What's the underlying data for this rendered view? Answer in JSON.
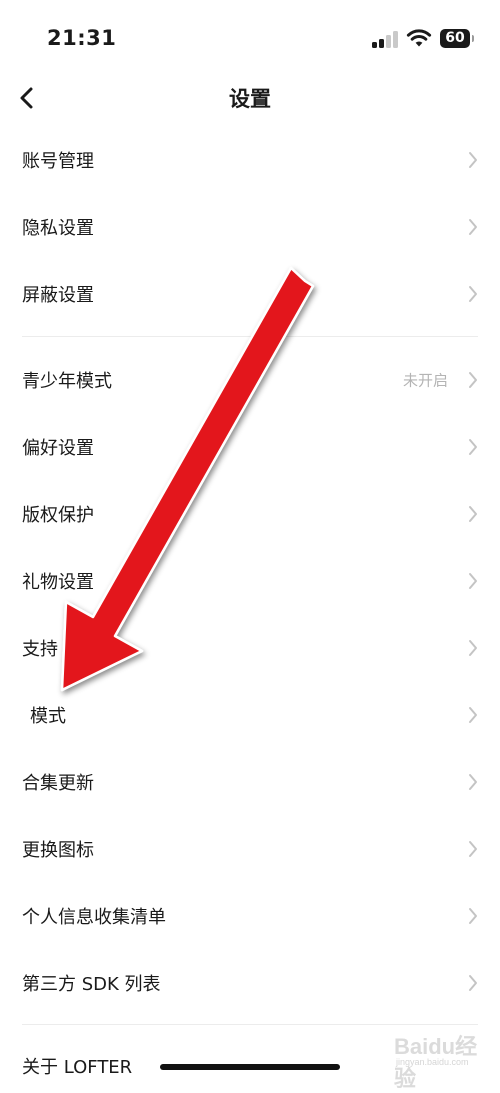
{
  "status_bar": {
    "time": "21:31",
    "battery": "60"
  },
  "nav": {
    "title": "设置"
  },
  "groups": [
    {
      "items": [
        {
          "label": "账号管理"
        },
        {
          "label": "隐私设置"
        },
        {
          "label": "屏蔽设置"
        }
      ]
    },
    {
      "items": [
        {
          "label": "青少年模式",
          "value": "未开启"
        },
        {
          "label": "偏好设置"
        },
        {
          "label": "版权保护"
        },
        {
          "label": "礼物设置"
        },
        {
          "label": "支持"
        },
        {
          "label": "模式"
        },
        {
          "label": "合集更新"
        },
        {
          "label": "更换图标"
        },
        {
          "label": "个人信息收集清单"
        },
        {
          "label": "第三方 SDK 列表"
        }
      ]
    }
  ],
  "about": {
    "label": "关于 LOFTER"
  },
  "watermark": {
    "brand": "Baidu经验",
    "site": "jingyan.baidu.com"
  },
  "colors": {
    "arrow": "#e3191b",
    "chevron": "#c4c4c4",
    "secondary_text": "#b4b4b4"
  },
  "icons": [
    "back-icon",
    "chevron-right-icon",
    "wifi-icon",
    "signal-icon",
    "battery-icon",
    "annotation-arrow"
  ]
}
